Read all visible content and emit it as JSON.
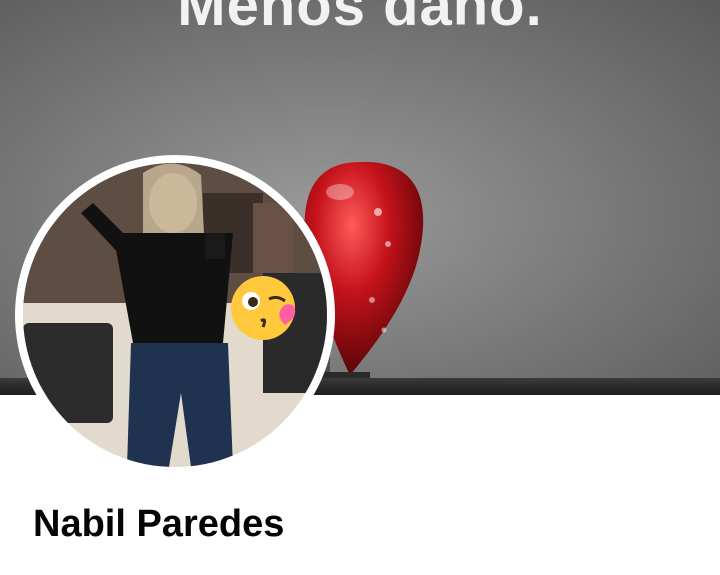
{
  "profile": {
    "cover_text": "Menos daño.",
    "name": "Nabil Paredes"
  },
  "icons": {
    "cover_image": "heart-balloon-cover-photo",
    "avatar": "profile-avatar-photo",
    "sticker": "kissing-face-emoji-icon"
  },
  "colors": {
    "background": "#ffffff",
    "name_text": "#050505",
    "heart": "#c4121a"
  }
}
